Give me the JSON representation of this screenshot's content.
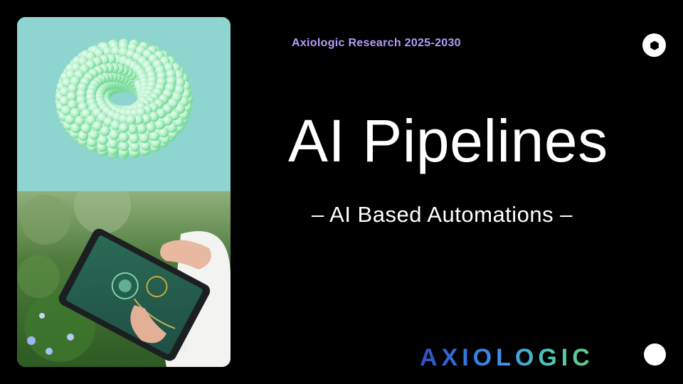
{
  "slide": {
    "eyebrow": "Axiologic Research 2025-2030",
    "title": "AI Pipelines",
    "subtitle": "– AI Based Automations –"
  },
  "brand": {
    "logo_text": "AXIOLOGIC",
    "logo_colors": [
      "#2f4fbd",
      "#3c8ff0",
      "#4fc7b2",
      "#5bcf80"
    ]
  },
  "images": {
    "top": "3D mint torus of spheres",
    "bottom": "hands holding tablet in garden"
  },
  "colors": {
    "background": "#000000",
    "accent": "#b49cf7",
    "panel_top": "#8ed4cf"
  }
}
